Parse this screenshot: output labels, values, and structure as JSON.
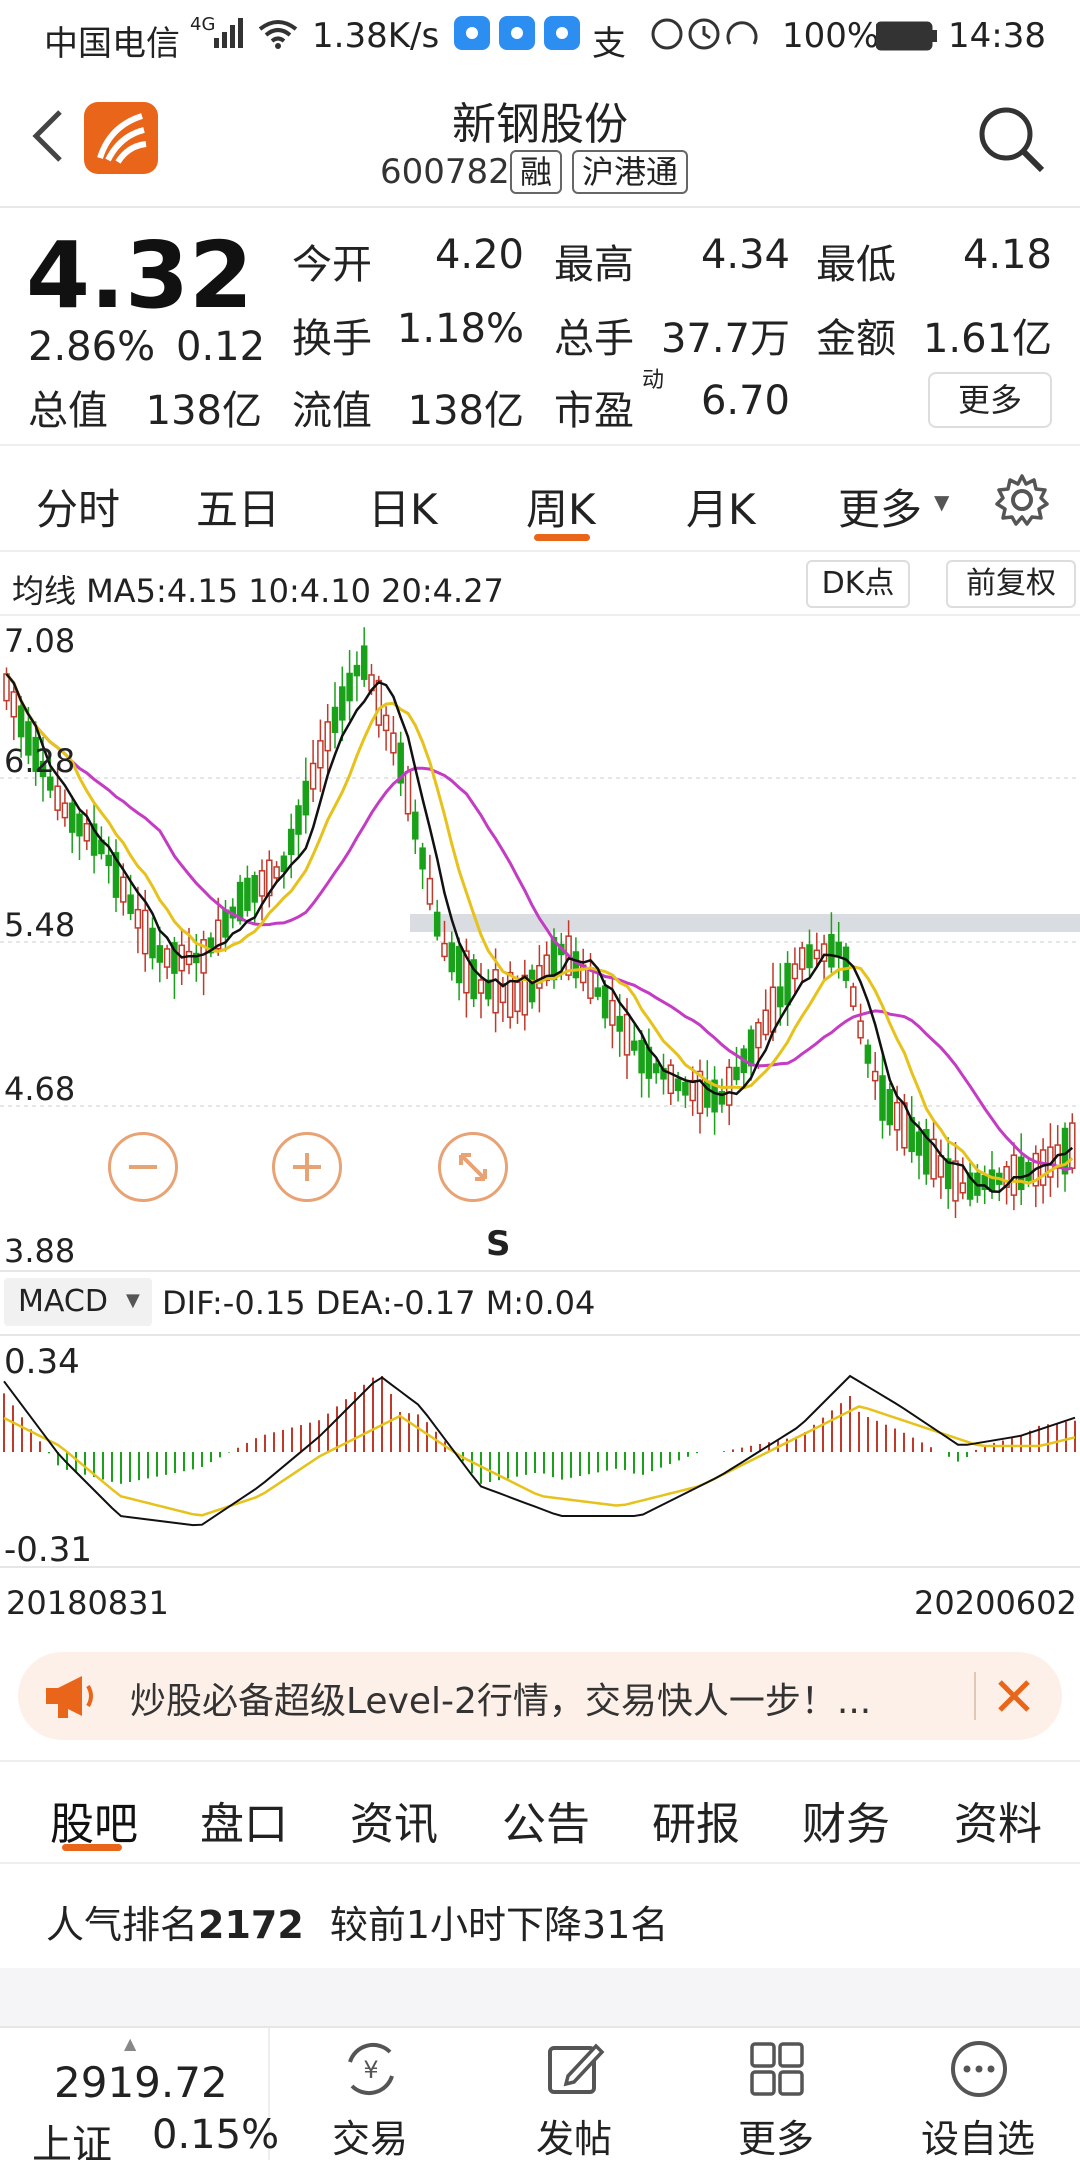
{
  "status_bar": {
    "carrier": "中国电信",
    "network": "4G",
    "speed": "1.38K/s",
    "alipay": "支",
    "battery": "100%",
    "time": "14:38"
  },
  "header": {
    "title": "新钢股份",
    "code": "600782",
    "tags": [
      "融",
      "沪港通"
    ]
  },
  "quote": {
    "price": "4.32",
    "change_pct": "2.86%",
    "change": "0.12",
    "total_value_label": "总值",
    "total_value": "138亿",
    "stats": [
      {
        "label": "今开",
        "value": "4.20"
      },
      {
        "label": "最高",
        "value": "4.34"
      },
      {
        "label": "最低",
        "value": "4.18"
      },
      {
        "label": "换手",
        "value": "1.18%"
      },
      {
        "label": "总手",
        "value": "37.7万"
      },
      {
        "label": "金额",
        "value": "1.61亿"
      },
      {
        "label": "流值",
        "value": "138亿"
      },
      {
        "label": "市盈",
        "sup": "动",
        "value": "6.70"
      }
    ],
    "more": "更多"
  },
  "period_tabs": [
    "分时",
    "五日",
    "日K",
    "周K",
    "月K",
    "更多"
  ],
  "active_period_tab": "周K",
  "ma_legend": "均线 MA5:4.15 10:4.10 20:4.27",
  "dk_button": "DK点",
  "fq_button": "前复权",
  "kline": {
    "y_labels": [
      "7.08",
      "6.28",
      "5.48",
      "4.68",
      "3.88"
    ],
    "marker": "S"
  },
  "macd": {
    "selector": "MACD",
    "values": "DIF:-0.15 DEA:-0.17 M:0.04",
    "y_labels": [
      "0.34",
      "-0.31"
    ]
  },
  "date_range": {
    "start": "20180831",
    "end": "20200602"
  },
  "banner": {
    "text": "炒股必备超级Level-2行情，交易快人一步！..."
  },
  "bottom_tabs": [
    "股吧",
    "盘口",
    "资讯",
    "公告",
    "研报",
    "财务",
    "资料"
  ],
  "popularity": {
    "prefix": "人气排名",
    "rank": "2172",
    "suffix": "较前1小时下降31名"
  },
  "index": {
    "value": "2919.72",
    "name": "上证",
    "change": "0.15%"
  },
  "nav": [
    "交易",
    "发帖",
    "更多",
    "设自选"
  ],
  "colors": {
    "up": "#c0392b",
    "down": "#1aa11a",
    "accent": "#e8651a",
    "ma5": "#111111",
    "ma10": "#e6c21a",
    "ma20": "#c43bc4"
  }
}
